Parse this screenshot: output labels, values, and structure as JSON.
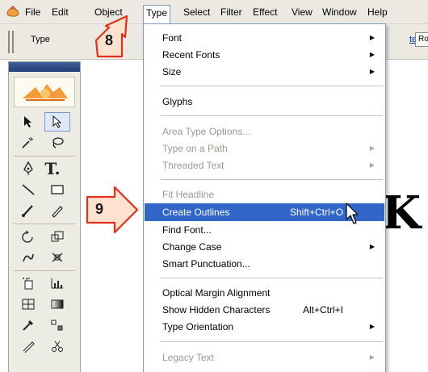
{
  "menubar": {
    "items": [
      "File",
      "Edit",
      "Object",
      "Type",
      "Select",
      "Filter",
      "Effect",
      "View",
      "Window",
      "Help"
    ],
    "open_item": "Type"
  },
  "controlbar": {
    "type_label": "Type",
    "character_link": "ter:",
    "font_value": "Ro"
  },
  "dropdown": {
    "font": "Font",
    "recent_fonts": "Recent Fonts",
    "size": "Size",
    "glyphs": "Glyphs",
    "area_type_options": "Area Type Options...",
    "type_on_a_path": "Type on a Path",
    "threaded_text": "Threaded Text",
    "fit_headline": "Fit Headline",
    "create_outlines": "Create Outlines",
    "create_outlines_shortcut": "Shift+Ctrl+O",
    "find_font": "Find Font...",
    "change_case": "Change Case",
    "smart_punctuation": "Smart Punctuation...",
    "optical_margin_alignment": "Optical Margin Alignment",
    "show_hidden_characters": "Show Hidden Characters",
    "show_hidden_characters_shortcut": "Alt+Ctrl+I",
    "type_orientation": "Type Orientation",
    "legacy_text": "Legacy Text"
  },
  "callouts": {
    "step_8": "8",
    "step_9": "9"
  },
  "canvas": {
    "big_text": ".K"
  },
  "colors": {
    "menubar_bg": "#ebe9e1",
    "highlight": "#3166c6",
    "disabled_text": "#9b9a95",
    "callout_stroke": "#e0301e",
    "callout_fill": "#fde2cf"
  },
  "icons": {
    "app": "illustrator-app-icon",
    "submenu": "submenu-arrow-icon",
    "cursor": "mouse-pointer-icon"
  }
}
